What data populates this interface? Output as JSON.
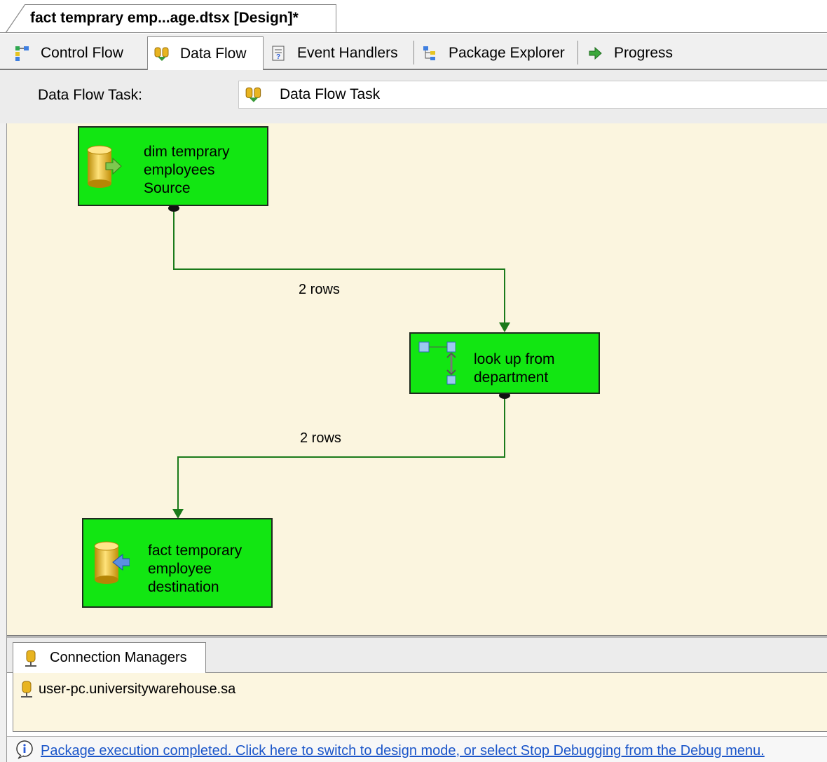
{
  "document_tab": {
    "title": "fact temprary emp...age.dtsx [Design]*"
  },
  "designer_tabs": [
    {
      "label": "Control Flow",
      "icon": "control-flow-icon",
      "active": false
    },
    {
      "label": "Data Flow",
      "icon": "data-flow-icon",
      "active": true
    },
    {
      "label": "Event Handlers",
      "icon": "event-handlers-icon",
      "active": false
    },
    {
      "label": "Package Explorer",
      "icon": "package-explorer-icon",
      "active": false
    },
    {
      "label": "Progress",
      "icon": "progress-arrow-icon",
      "active": false
    }
  ],
  "task_selector": {
    "label": "Data Flow Task:",
    "value": "Data Flow Task",
    "icon": "data-flow-icon"
  },
  "canvas": {
    "background": "#fbf5df",
    "component_color": "#12e612",
    "path_color": "#1a7a1a",
    "components": [
      {
        "id": "source",
        "lines": [
          "dim temprary",
          "employees",
          "Source"
        ],
        "icon": "ole-db-source-icon"
      },
      {
        "id": "lookup",
        "lines": [
          "look up from",
          "department"
        ],
        "icon": "lookup-transform-icon"
      },
      {
        "id": "destination",
        "lines": [
          "fact temporary",
          "employee",
          "destination"
        ],
        "icon": "ole-db-destination-icon"
      }
    ],
    "paths": [
      {
        "from": "source",
        "to": "lookup",
        "label": "2 rows"
      },
      {
        "from": "lookup",
        "to": "destination",
        "label": "2 rows"
      }
    ]
  },
  "connection_managers": {
    "tab_label": "Connection Managers",
    "items": [
      {
        "label": "user-pc.universitywarehouse.sa",
        "icon": "connection-manager-icon"
      }
    ]
  },
  "status_bar": {
    "icon": "info-icon",
    "message": "Package execution completed. Click here to switch to design mode, or select Stop Debugging from the Debug menu."
  }
}
